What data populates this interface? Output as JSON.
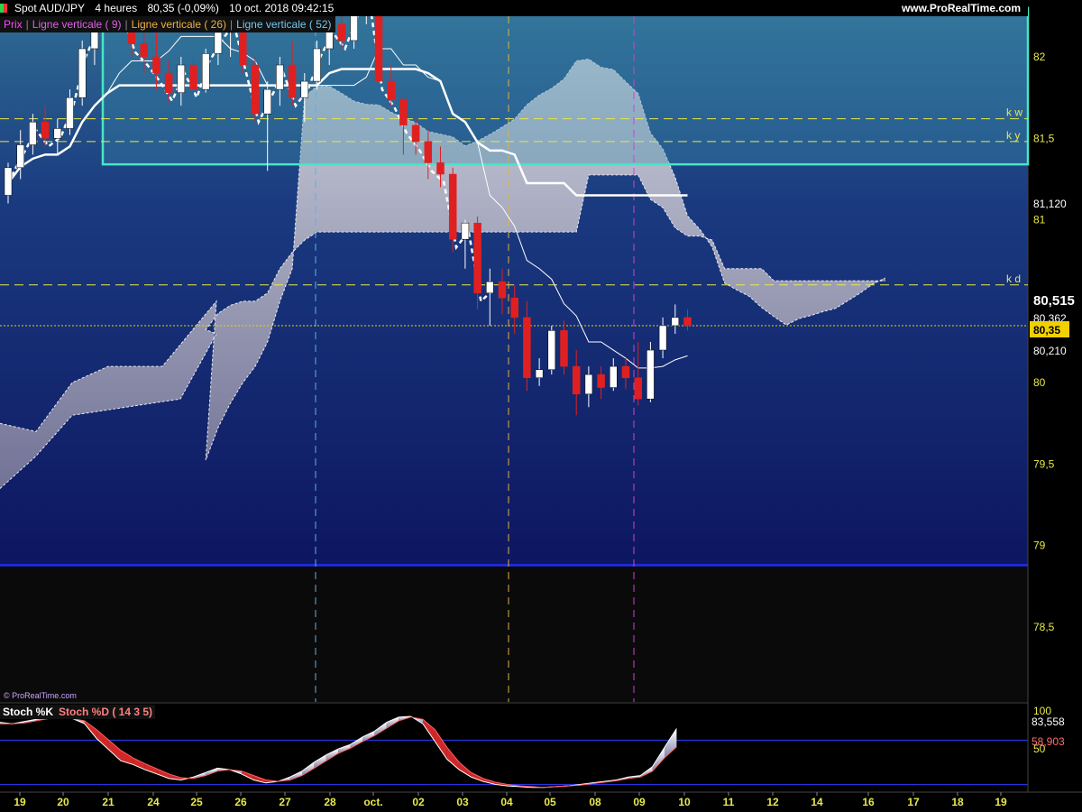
{
  "header": {
    "instrument": "Spot AUD/JPY",
    "timeframe": "4 heures",
    "last": "80,35 (-0,09%)",
    "datetime": "10 oct. 2018 09:42:15",
    "site": "www.ProRealTime.com"
  },
  "legend": {
    "prix": "Prix",
    "v9": "Ligne verticale ( 9)",
    "v26": "Ligne verticale ( 26)",
    "v52": "Ligne verticale ( 52)"
  },
  "watermark": "© ProRealTime.com",
  "stoch_legend": {
    "k": "Stoch %K",
    "d": "Stoch %D ( 14 3 5)"
  },
  "colors": {
    "bg_top": "#2e6a92",
    "bg_bottom": "#0d1660",
    "box": "#45e6c8",
    "bull": "#ffffff",
    "bear": "#e02020",
    "kumo": "#c8c8d2",
    "level_line": "#e8e84c",
    "support_line": "#1e2ee6",
    "v9": "#d040d8",
    "v26": "#e0b040",
    "v52": "#60b0e0",
    "price_tag": "#f0d000"
  },
  "chart_data": [
    {
      "type": "candlestick",
      "title": "Spot AUD/JPY",
      "timeframe": "4 heures",
      "x_ticks": [
        "19",
        "20",
        "21",
        "24",
        "25",
        "26",
        "27",
        "28",
        "oct.",
        "02",
        "03",
        "04",
        "05",
        "08",
        "09",
        "10",
        "11",
        "12",
        "14",
        "16",
        "17",
        "18",
        "19"
      ],
      "y_ticks": [
        "82",
        "81,5",
        "81",
        "80",
        "79,5",
        "79",
        "78,5"
      ],
      "ylim": [
        78.0,
        82.3
      ],
      "last_price": "80,35",
      "price_labels": [
        "81,120",
        "80,515",
        "80,362",
        "80,35",
        "80,210"
      ],
      "levels": [
        {
          "name": "k w",
          "value": 81.62
        },
        {
          "name": "k y",
          "value": 81.48
        },
        {
          "name": "k d",
          "value": 80.6
        }
      ],
      "support_level": 78.88,
      "range_box": {
        "from": "21",
        "to": "19",
        "high": 82.3,
        "low": 81.34
      },
      "vertical_lines": [
        {
          "name": "Ligne verticale ( 52)",
          "at": "27"
        },
        {
          "name": "Ligne verticale ( 26)",
          "at": "04"
        },
        {
          "name": "Ligne verticale ( 9)",
          "at": "09"
        }
      ],
      "candles": [
        [
          81.15,
          81.35,
          81.1,
          81.32
        ],
        [
          81.32,
          81.55,
          81.25,
          81.46
        ],
        [
          81.46,
          81.65,
          81.4,
          81.6
        ],
        [
          81.6,
          81.7,
          81.45,
          81.5
        ],
        [
          81.5,
          81.62,
          81.4,
          81.56
        ],
        [
          81.56,
          81.8,
          81.52,
          81.75
        ],
        [
          81.75,
          82.1,
          81.7,
          82.05
        ],
        [
          82.05,
          82.3,
          81.95,
          82.22
        ],
        [
          82.22,
          82.45,
          82.15,
          82.4
        ],
        [
          82.4,
          82.55,
          82.2,
          82.3
        ],
        [
          82.3,
          82.4,
          82.0,
          82.08
        ],
        [
          82.08,
          82.2,
          81.9,
          82.0
        ],
        [
          82.0,
          82.15,
          81.8,
          81.9
        ],
        [
          81.9,
          81.98,
          81.72,
          81.78
        ],
        [
          81.78,
          82.0,
          81.7,
          81.95
        ],
        [
          81.95,
          82.0,
          81.75,
          81.8
        ],
        [
          81.8,
          82.05,
          81.78,
          82.02
        ],
        [
          82.02,
          82.2,
          81.95,
          82.15
        ],
        [
          82.15,
          82.3,
          82.0,
          82.25
        ],
        [
          82.25,
          82.35,
          81.9,
          81.95
        ],
        [
          81.95,
          82.0,
          81.6,
          81.65
        ],
        [
          81.65,
          81.85,
          81.3,
          81.8
        ],
        [
          81.8,
          82.0,
          81.7,
          81.95
        ],
        [
          81.95,
          82.1,
          81.7,
          81.75
        ],
        [
          81.75,
          81.9,
          81.6,
          81.85
        ],
        [
          81.85,
          82.1,
          81.8,
          82.05
        ],
        [
          82.05,
          82.25,
          81.95,
          82.2
        ],
        [
          82.2,
          82.3,
          82.05,
          82.1
        ],
        [
          82.1,
          82.35,
          82.05,
          82.3
        ],
        [
          82.3,
          82.45,
          82.2,
          82.38
        ],
        [
          82.38,
          82.5,
          82.1,
          81.85
        ],
        [
          81.85,
          81.95,
          81.7,
          81.74
        ],
        [
          81.74,
          81.8,
          81.4,
          81.58
        ],
        [
          81.58,
          81.62,
          81.4,
          81.48
        ],
        [
          81.48,
          81.55,
          81.25,
          81.35
        ],
        [
          81.35,
          81.45,
          81.2,
          81.28
        ],
        [
          81.28,
          81.32,
          80.8,
          80.88
        ],
        [
          80.88,
          81.0,
          80.7,
          80.98
        ],
        [
          80.98,
          81.02,
          80.45,
          80.55
        ],
        [
          80.55,
          80.7,
          80.35,
          80.62
        ],
        [
          80.62,
          80.7,
          80.42,
          80.52
        ],
        [
          80.52,
          80.6,
          80.3,
          80.4
        ],
        [
          80.4,
          80.5,
          79.95,
          80.03
        ],
        [
          80.03,
          80.15,
          79.98,
          80.08
        ],
        [
          80.08,
          80.35,
          80.05,
          80.32
        ],
        [
          80.32,
          80.38,
          80.05,
          80.1
        ],
        [
          80.1,
          80.2,
          79.8,
          79.93
        ],
        [
          79.93,
          80.1,
          79.85,
          80.05
        ],
        [
          80.05,
          80.1,
          79.9,
          79.97
        ],
        [
          79.97,
          80.15,
          79.95,
          80.1
        ],
        [
          80.1,
          80.15,
          79.96,
          80.03
        ],
        [
          80.03,
          80.25,
          79.86,
          79.9
        ],
        [
          79.9,
          80.25,
          79.88,
          80.2
        ],
        [
          80.2,
          80.4,
          80.15,
          80.35
        ],
        [
          80.35,
          80.48,
          80.3,
          80.4
        ],
        [
          80.4,
          80.45,
          80.32,
          80.35
        ]
      ],
      "series": [
        {
          "name": "Tenkan"
        },
        {
          "name": "Kijun"
        },
        {
          "name": "Chikou"
        },
        {
          "name": "Senkou A"
        },
        {
          "name": "Senkou B"
        }
      ]
    },
    {
      "type": "area",
      "title": "Stoch %K / Stoch %D ( 14 3 5)",
      "y_ticks": [
        "100",
        "50"
      ],
      "ylim": [
        0,
        100
      ],
      "price_labels": [
        "83,558",
        "58,903"
      ],
      "band_lines": [
        80,
        20
      ],
      "k": [
        92,
        90,
        93,
        96,
        99,
        98,
        97,
        90,
        70,
        55,
        40,
        35,
        28,
        22,
        16,
        14,
        18,
        24,
        30,
        28,
        22,
        14,
        10,
        12,
        18,
        26,
        38,
        48,
        56,
        62,
        72,
        80,
        92,
        99,
        100,
        90,
        66,
        42,
        28,
        18,
        12,
        8,
        6,
        5,
        4,
        4,
        5,
        6,
        8,
        10,
        12,
        14,
        18,
        20,
        32,
        58,
        83.558
      ],
      "d": [
        90,
        90,
        91,
        94,
        97,
        98,
        97,
        94,
        82,
        68,
        54,
        44,
        36,
        29,
        22,
        17,
        16,
        20,
        26,
        28,
        26,
        20,
        14,
        12,
        14,
        20,
        30,
        40,
        50,
        57,
        66,
        74,
        84,
        94,
        99,
        96,
        82,
        58,
        38,
        24,
        16,
        11,
        8,
        6,
        5,
        4,
        5,
        6,
        7,
        9,
        11,
        13,
        16,
        18,
        26,
        44,
        58.903
      ]
    }
  ]
}
